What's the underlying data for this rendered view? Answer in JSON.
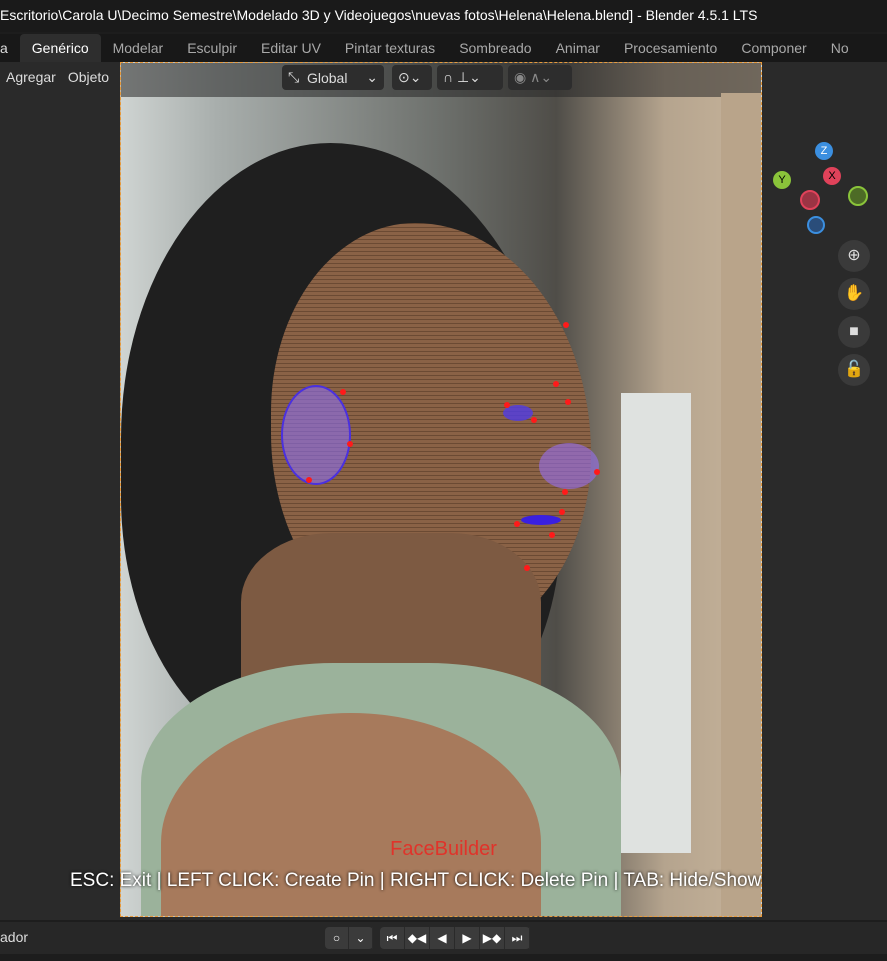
{
  "window": {
    "title": "Escritorio\\Carola U\\Decimo Semestre\\Modelado 3D y Videojuegos\\nuevas fotos\\Helena\\Helena.blend] - Blender 4.5.1 LTS"
  },
  "workspaces": {
    "partial": "a",
    "tabs": [
      "Genérico",
      "Modelar",
      "Esculpir",
      "Editar UV",
      "Pintar texturas",
      "Sombreado",
      "Animar",
      "Procesamiento",
      "Componer",
      "No"
    ],
    "active": "Genérico"
  },
  "header": {
    "menus": [
      "Agregar",
      "Objeto"
    ],
    "transform_orientation": "Global"
  },
  "gizmo": {
    "axes": [
      "Z",
      "Y",
      "X"
    ],
    "colors": {
      "x": "#e0425a",
      "y": "#8ac43a",
      "z": "#3b8fe0"
    }
  },
  "nav": {
    "zoom": "zoom-icon",
    "pan": "hand-icon",
    "camera": "camera-icon",
    "lock": "lock-icon"
  },
  "overlay": {
    "addon": "FaceBuilder",
    "help": "ESC: Exit | LEFT CLICK: Create Pin | RIGHT CLICK: Delete Pin | TAB: Hide/Show"
  },
  "timeline": {
    "label": "ador",
    "buttons": [
      "⏮",
      "◆◀",
      "◀",
      "▶",
      "▶◆",
      "⏭"
    ]
  }
}
